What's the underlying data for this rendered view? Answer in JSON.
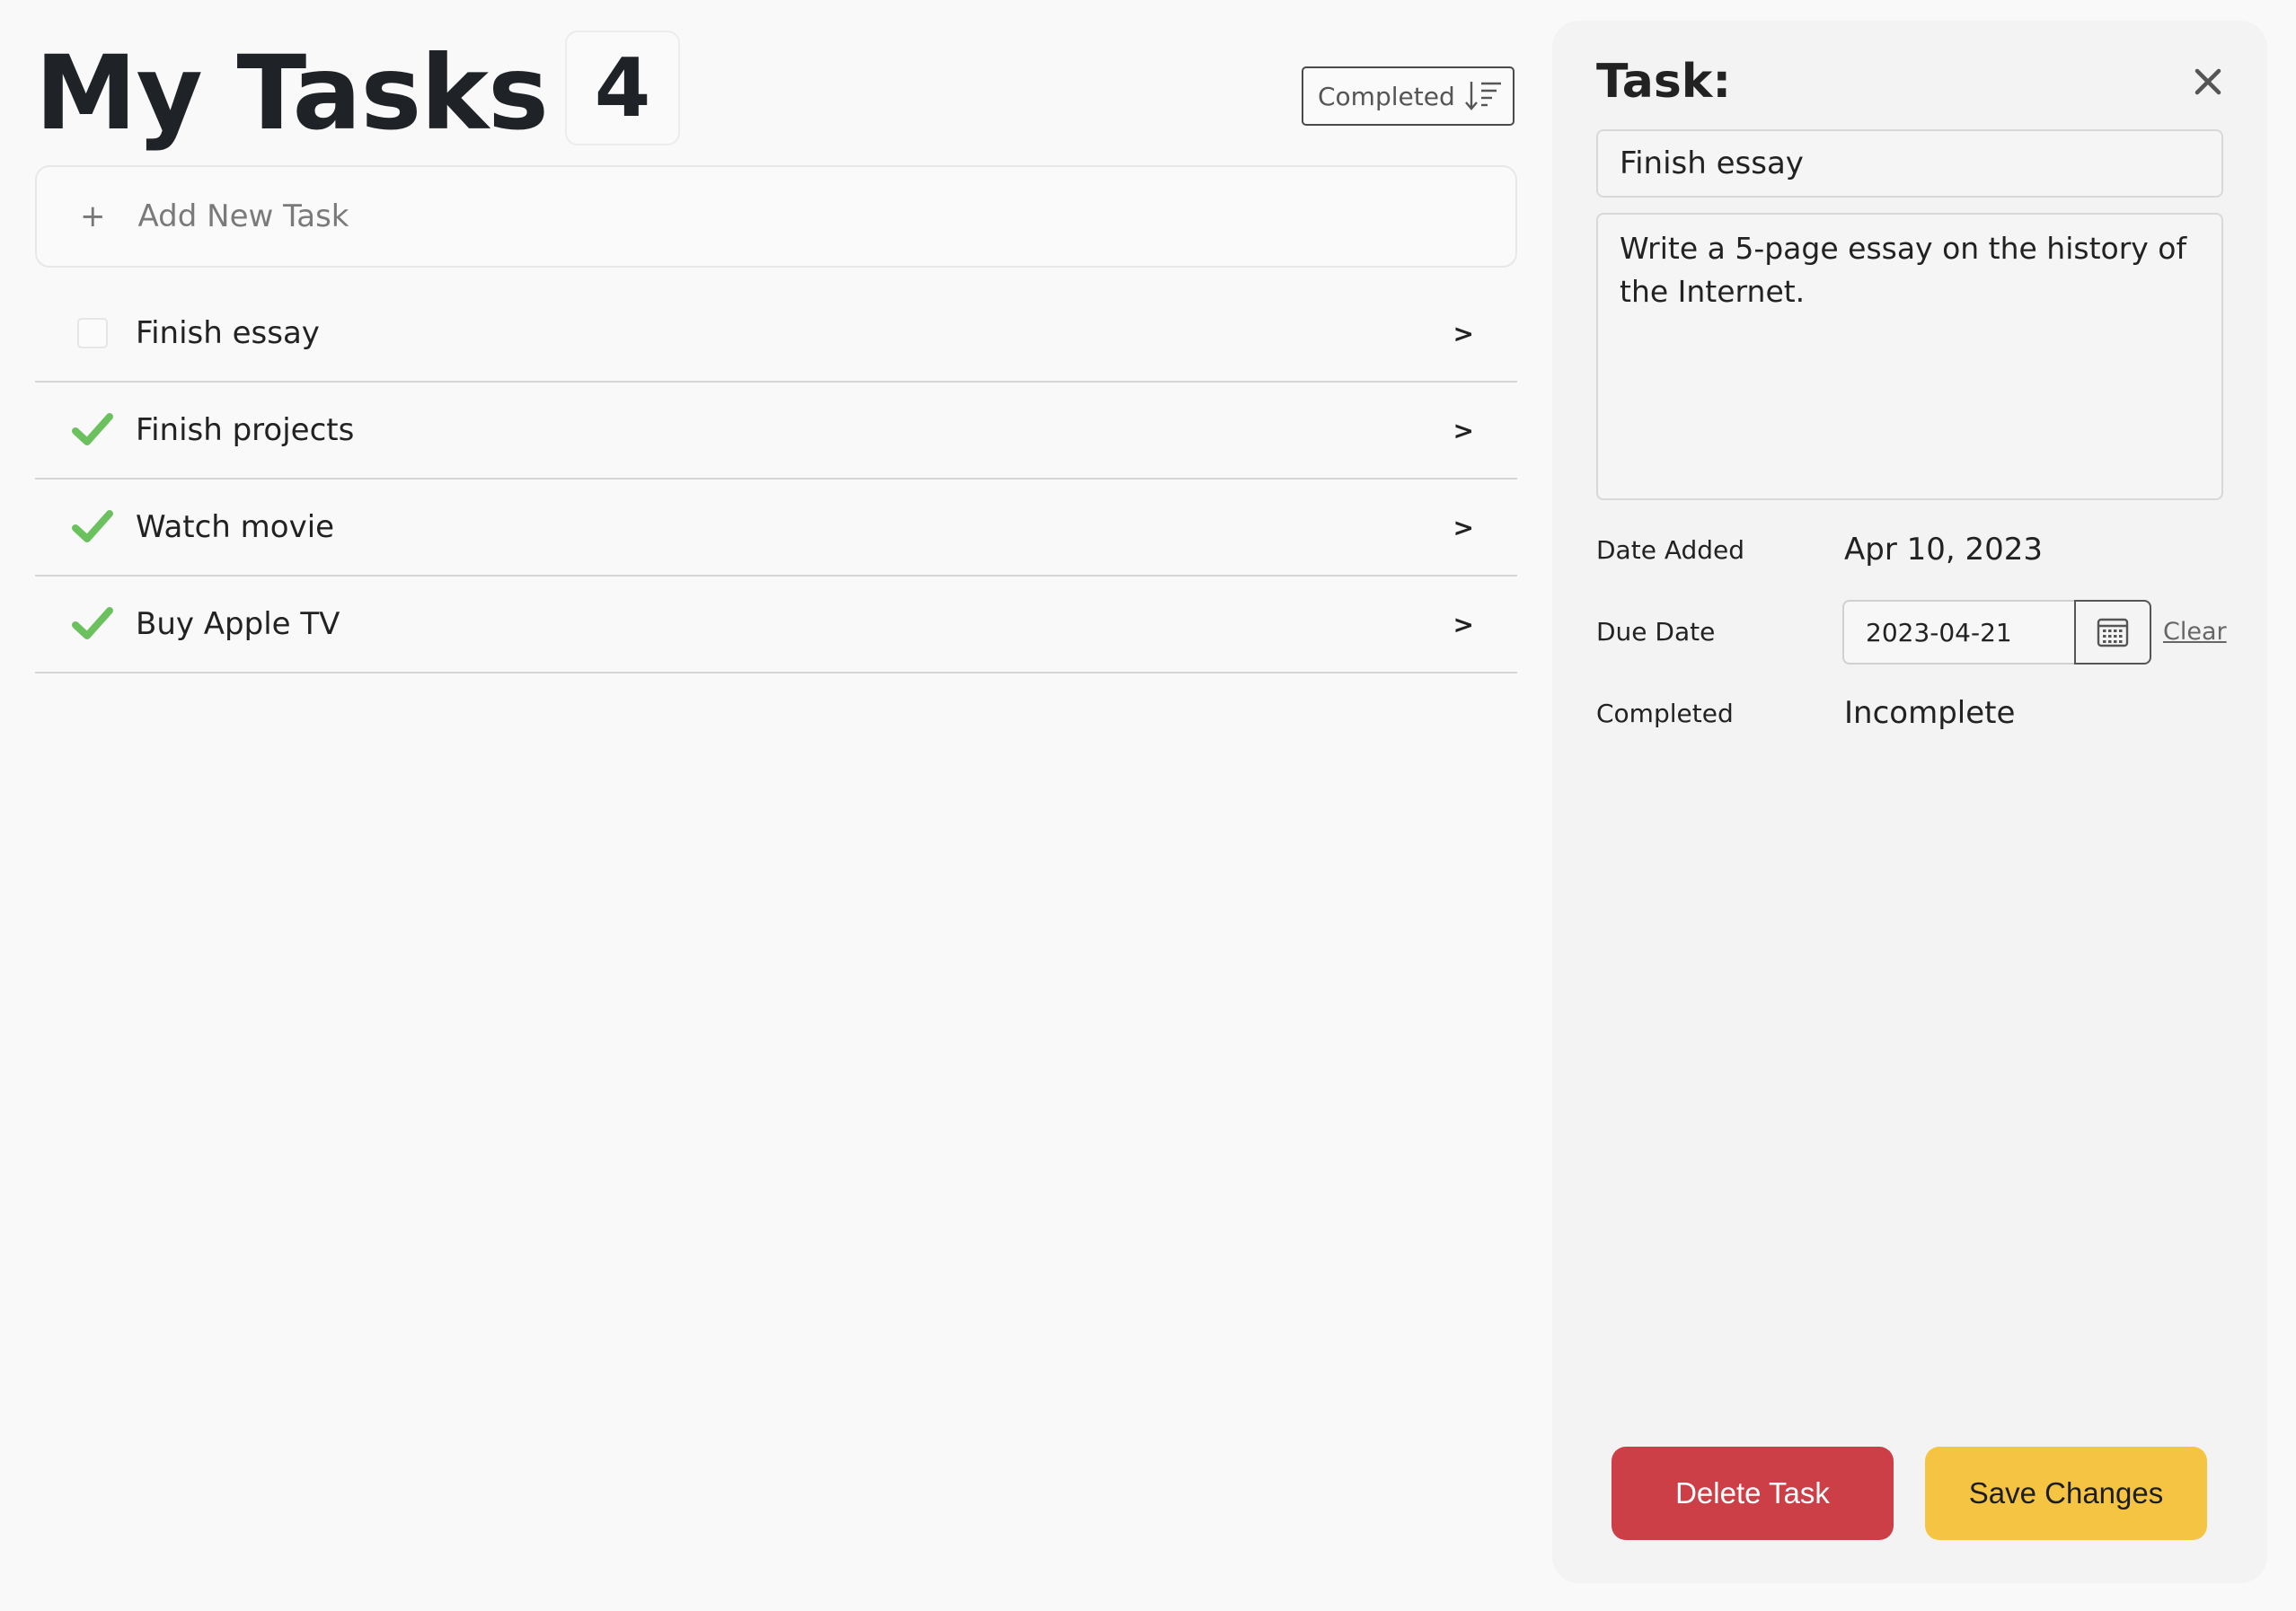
{
  "header": {
    "title": "My Tasks",
    "count": "4",
    "sort_label": "Completed"
  },
  "add_task": {
    "plus": "+",
    "placeholder": "Add New Task"
  },
  "tasks": [
    {
      "label": "Finish essay",
      "completed": false,
      "chevron": ">"
    },
    {
      "label": "Finish projects",
      "completed": true,
      "chevron": ">"
    },
    {
      "label": "Watch movie",
      "completed": true,
      "chevron": ">"
    },
    {
      "label": "Buy Apple TV",
      "completed": true,
      "chevron": ">"
    }
  ],
  "detail": {
    "title": "Task:",
    "name_value": "Finish essay",
    "description_value": "Write a 5-page essay on the history of the Internet.",
    "date_added_label": "Date Added",
    "date_added_value": "Apr 10, 2023",
    "due_date_label": "Due Date",
    "due_date_value": "2023-04-21",
    "clear_label": "Clear",
    "completed_label": "Completed",
    "completed_value": "Incomplete",
    "delete_label": "Delete Task",
    "save_label": "Save Changes"
  },
  "colors": {
    "check": "#6cc15f",
    "delete": "#cd3f47",
    "save": "#f5c443"
  }
}
